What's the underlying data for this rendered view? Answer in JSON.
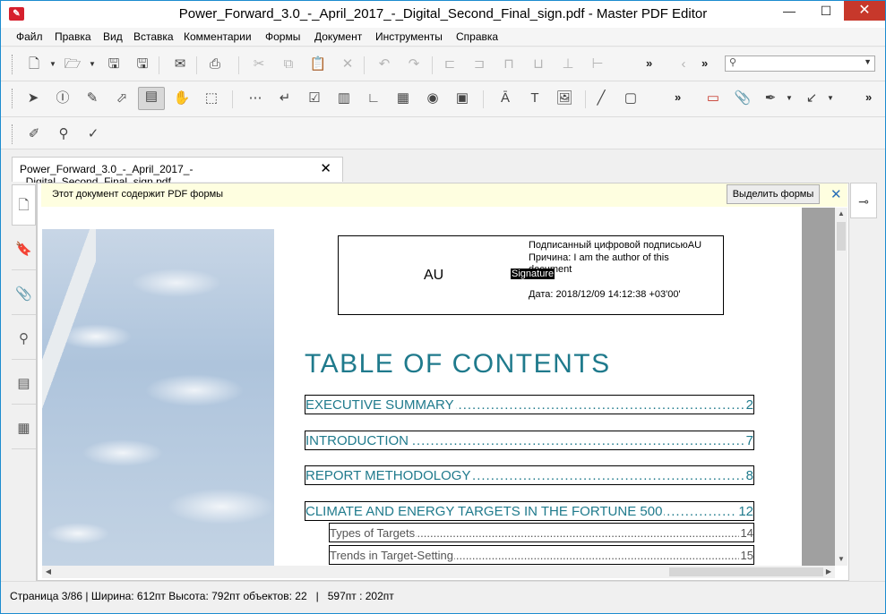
{
  "window": {
    "title": "Power_Forward_3.0_-_April_2017_-_Digital_Second_Final_sign.pdf - Master PDF Editor",
    "app_icon": "pdf-icon",
    "minimize": "—",
    "maximize": "☐",
    "close": "✕"
  },
  "menu": [
    "Файл",
    "Правка",
    "Вид",
    "Вставка",
    "Комментарии",
    "Формы",
    "Документ",
    "Инструменты",
    "Справка"
  ],
  "search": {
    "placeholder": ""
  },
  "tab": {
    "label": "Power_Forward_3.0_-_April_2017_-_Digital_Second_Final_sign.pdf",
    "close": "✕"
  },
  "forms_bar": {
    "message": "Этот документ содержит PDF формы",
    "highlight_button": "Выделить формы",
    "close": "✕"
  },
  "signature": {
    "name": "AU",
    "line1": "Подписанный цифровой подписьюAU",
    "line2": "Причина: I am the author of this document",
    "field_label": "Signature",
    "date": "Дата: 2018/12/09 14:12:38 +03'00'"
  },
  "toc": {
    "title": "TABLE OF CONTENTS",
    "entries": [
      {
        "label": "EXECUTIVE SUMMARY",
        "page": "2"
      },
      {
        "label": "INTRODUCTION",
        "page": "7"
      },
      {
        "label": "REPORT METHODOLOGY",
        "page": "8"
      },
      {
        "label": "CLIMATE AND ENERGY TARGETS IN THE FORTUNE 500",
        "page": "12"
      }
    ],
    "subentries": [
      {
        "label": "Types of Targets",
        "page": "14"
      },
      {
        "label": "Trends in Target-Setting",
        "page": "15"
      }
    ]
  },
  "status": {
    "text": "Страница 3/86 | Ширина: 612пт Высота: 792пт объектов: 22   |   597пт : 202пт"
  },
  "colors": {
    "accent": "#1f7a8c",
    "forms_bar": "#fefee0",
    "close_red": "#c7382b"
  }
}
